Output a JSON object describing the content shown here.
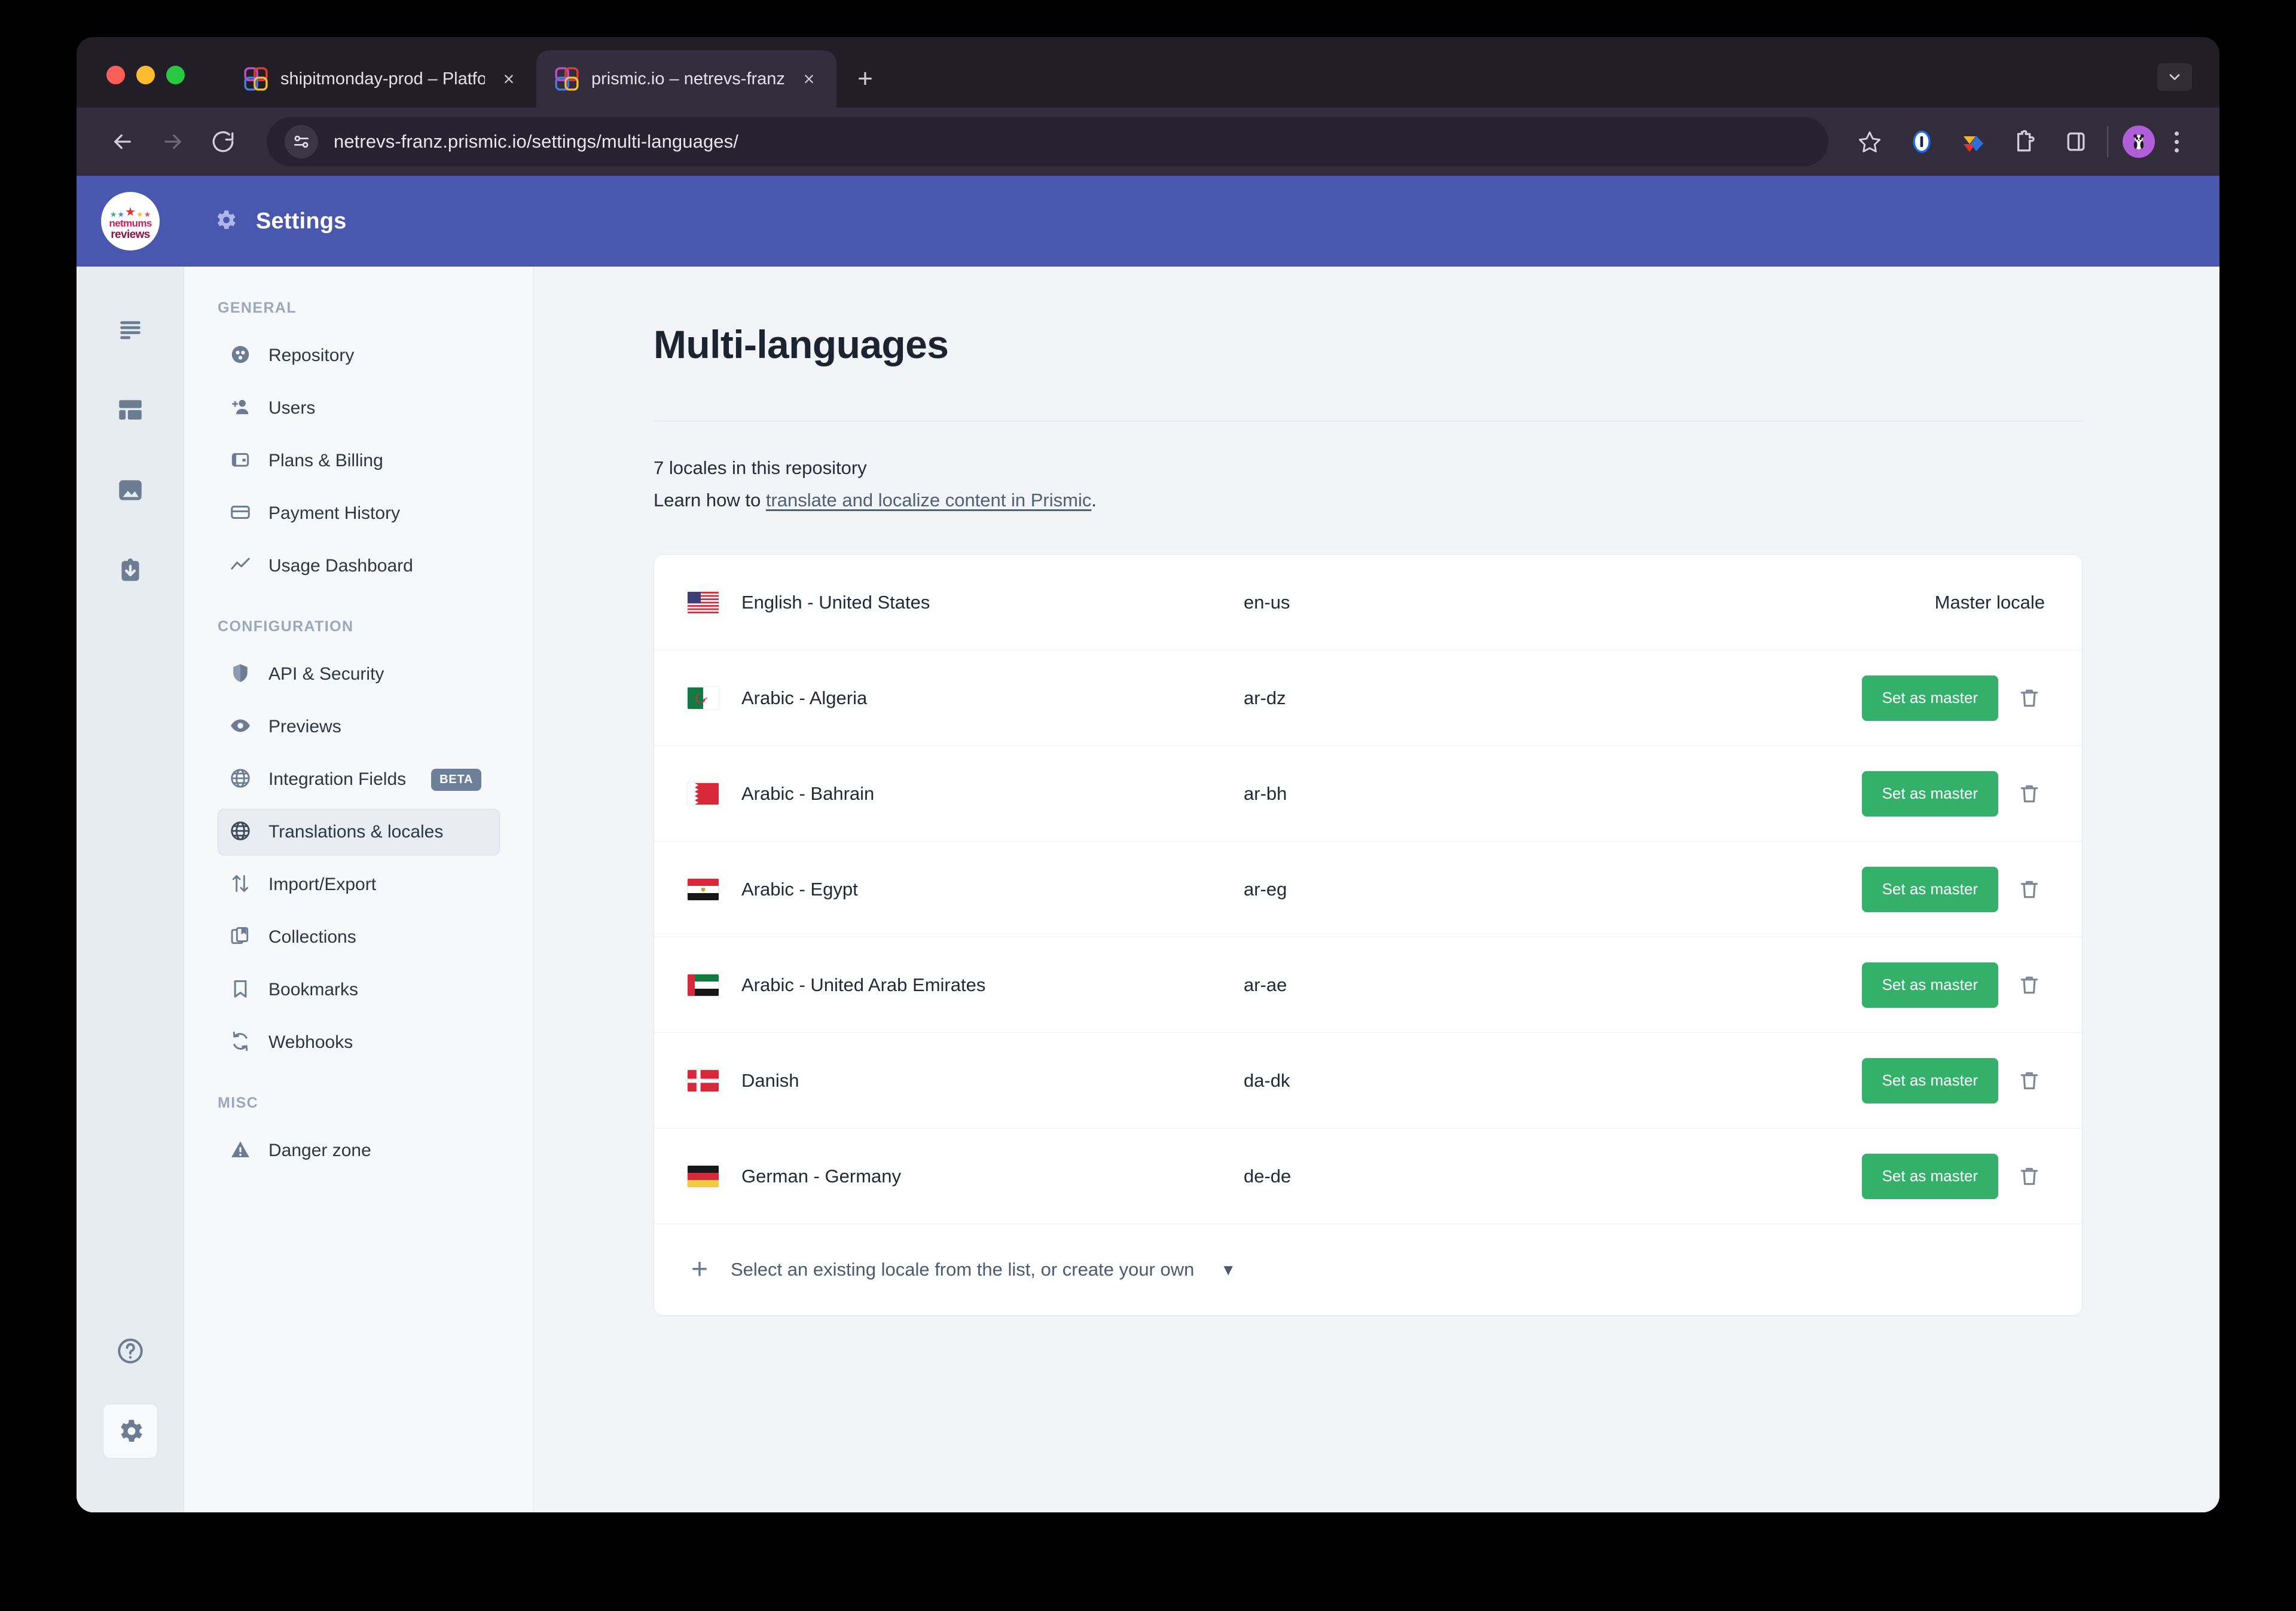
{
  "browser": {
    "tabs": [
      {
        "title": "shipitmonday-prod – Platform",
        "favicon": "prismic-icon",
        "active": false,
        "close_label": "×"
      },
      {
        "title": "prismic.io – netrevs-franz",
        "favicon": "prismic-icon",
        "active": true,
        "close_label": "×"
      }
    ],
    "new_tab_label": "+",
    "url": "netrevs-franz.prismic.io/settings/multi-languages/",
    "nav_icons": [
      "back-arrow-icon",
      "forward-arrow-icon",
      "reload-icon"
    ],
    "site_info_icon": "site-settings-tune-icon",
    "bookmark_icon": "star-outline-icon",
    "extension_icons": [
      "onepassword-icon",
      "colorful-diamond-extension-icon",
      "puzzle-extensions-icon",
      "side-panel-icon"
    ],
    "profile_icon": "panda-avatar-icon",
    "menu_icon": "three-dot-menu-icon",
    "tabstrip_menu_icon": "chevron-down-icon"
  },
  "app": {
    "logo": {
      "name": "netmums-reviews-logo",
      "line1": "netmums",
      "line2": "reviews"
    },
    "header": {
      "icon": "gear-icon",
      "title": "Settings"
    },
    "rail": [
      {
        "name": "documents-icon"
      },
      {
        "name": "custom-types-icon"
      },
      {
        "name": "media-library-icon"
      },
      {
        "name": "releases-icon"
      }
    ],
    "rail_bottom": [
      {
        "name": "help-circle-icon",
        "active": false
      },
      {
        "name": "gear-icon",
        "active": true
      }
    ]
  },
  "sidebar": {
    "sections": [
      {
        "label": "GENERAL",
        "items": [
          {
            "label": "Repository",
            "icon": "repository-icon",
            "selected": false
          },
          {
            "label": "Users",
            "icon": "add-user-icon",
            "selected": false
          },
          {
            "label": "Plans & Billing",
            "icon": "wallet-icon",
            "selected": false
          },
          {
            "label": "Payment History",
            "icon": "credit-card-icon",
            "selected": false
          },
          {
            "label": "Usage Dashboard",
            "icon": "line-chart-icon",
            "selected": false
          }
        ]
      },
      {
        "label": "CONFIGURATION",
        "items": [
          {
            "label": "API & Security",
            "icon": "shield-icon",
            "selected": false
          },
          {
            "label": "Previews",
            "icon": "eye-icon",
            "selected": false
          },
          {
            "label": "Integration Fields",
            "icon": "globe-icon",
            "selected": false,
            "badge": "BETA"
          },
          {
            "label": "Translations & locales",
            "icon": "globe-icon",
            "selected": true
          },
          {
            "label": "Import/Export",
            "icon": "updown-arrows-icon",
            "selected": false
          },
          {
            "label": "Collections",
            "icon": "collections-icon",
            "selected": false
          },
          {
            "label": "Bookmarks",
            "icon": "bookmark-icon",
            "selected": false
          },
          {
            "label": "Webhooks",
            "icon": "refresh-icon",
            "selected": false
          }
        ]
      },
      {
        "label": "MISC",
        "items": [
          {
            "label": "Danger zone",
            "icon": "warning-triangle-icon",
            "selected": false
          }
        ]
      }
    ]
  },
  "main": {
    "page_title": "Multi-languages",
    "locales_count_text": "7 locales in this repository",
    "learn_prefix": "Learn how to ",
    "learn_link": "translate and localize content in Prismic",
    "learn_suffix": ".",
    "master_locale_label": "Master locale",
    "set_as_master_label": "Set as master",
    "delete_icon": "trash-icon",
    "add_row": {
      "plus_icon": "plus-icon",
      "label": "Select an existing locale from the list, or create your own",
      "chevron": "chevron-down-icon"
    },
    "locales": [
      {
        "name": "English - United States",
        "code": "en-us",
        "flag": "us",
        "is_master": true
      },
      {
        "name": "Arabic - Algeria",
        "code": "ar-dz",
        "flag": "dz",
        "is_master": false
      },
      {
        "name": "Arabic - Bahrain",
        "code": "ar-bh",
        "flag": "bh",
        "is_master": false
      },
      {
        "name": "Arabic - Egypt",
        "code": "ar-eg",
        "flag": "eg",
        "is_master": false
      },
      {
        "name": "Arabic - United Arab Emirates",
        "code": "ar-ae",
        "flag": "ae",
        "is_master": false
      },
      {
        "name": "Danish",
        "code": "da-dk",
        "flag": "dk",
        "is_master": false
      },
      {
        "name": "German - Germany",
        "code": "de-de",
        "flag": "de",
        "is_master": false
      }
    ]
  },
  "colors": {
    "header_purple": "#4a57af",
    "green_button": "#34b06a",
    "page_bg": "#f2f4f7",
    "rail_bg": "#e7ecf1",
    "sidebar_bg": "#f7f8fa"
  }
}
